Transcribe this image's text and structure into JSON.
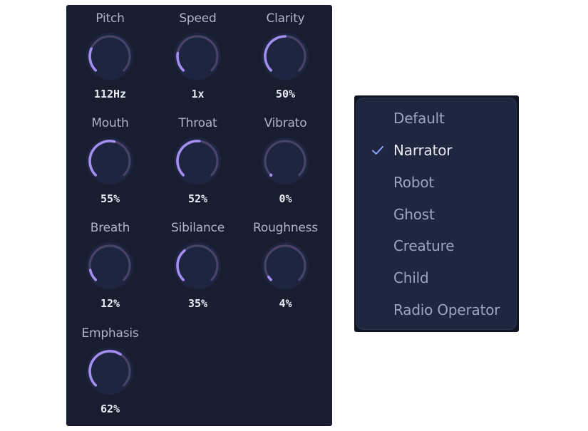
{
  "colors": {
    "panel_bg": "#181e30",
    "knob_face": "#1e2540",
    "knob_track": "#4a4368",
    "knob_accent": "#a48ef0",
    "menu_bg": "#1e2640",
    "check": "#8aa6ff"
  },
  "knobs": [
    {
      "label": "Pitch",
      "value": "112Hz",
      "level": 0.25
    },
    {
      "label": "Speed",
      "value": "1x",
      "level": 0.2
    },
    {
      "label": "Clarity",
      "value": "50%",
      "level": 0.5
    },
    {
      "label": "Mouth",
      "value": "55%",
      "level": 0.55
    },
    {
      "label": "Throat",
      "value": "52%",
      "level": 0.52
    },
    {
      "label": "Vibrato",
      "value": "0%",
      "level": 0.0
    },
    {
      "label": "Breath",
      "value": "12%",
      "level": 0.12
    },
    {
      "label": "Sibilance",
      "value": "35%",
      "level": 0.35
    },
    {
      "label": "Roughness",
      "value": "4%",
      "level": 0.04
    },
    {
      "label": "Emphasis",
      "value": "62%",
      "level": 0.62
    }
  ],
  "menu": {
    "selected_icon": "checkmark-icon",
    "items": [
      {
        "label": "Default",
        "selected": false
      },
      {
        "label": "Narrator",
        "selected": true
      },
      {
        "label": "Robot",
        "selected": false
      },
      {
        "label": "Ghost",
        "selected": false
      },
      {
        "label": "Creature",
        "selected": false
      },
      {
        "label": "Child",
        "selected": false
      },
      {
        "label": "Radio Operator",
        "selected": false
      }
    ]
  }
}
